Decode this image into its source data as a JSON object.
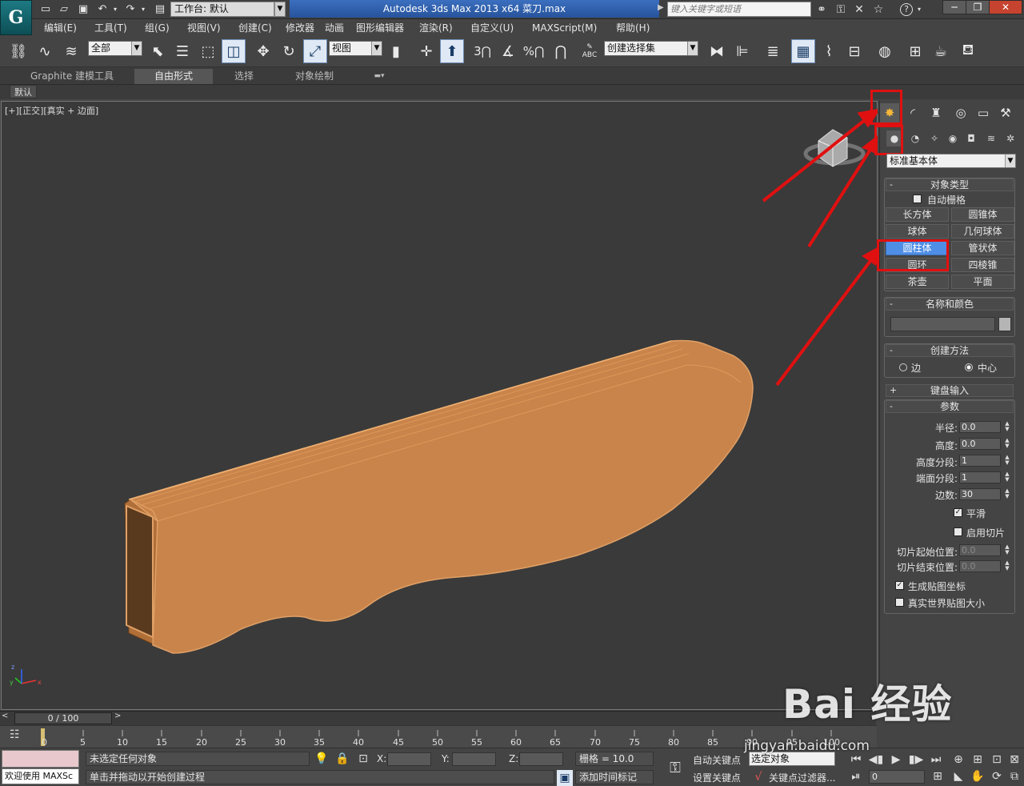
{
  "titlebar": {
    "logo": "G",
    "workspace": "工作台: 默认",
    "app_title": "Autodesk 3ds Max  2013 x64        菜刀.max",
    "search_placeholder": "键入关键字或短语",
    "help": "?"
  },
  "menus": [
    "编辑(E)",
    "工具(T)",
    "组(G)",
    "视图(V)",
    "创建(C)",
    "修改器",
    "动画",
    "图形编辑器",
    "渲染(R)",
    "自定义(U)",
    "MAXScript(M)",
    "帮助(H)"
  ],
  "toolbar": {
    "filter": "全部",
    "ref_coord": "视图",
    "named_sel": "创建选择集",
    "snap_3": "3",
    "percent": "%",
    "abc": "ABC"
  },
  "ribbon": {
    "tabs": [
      "Graphite 建模工具",
      "自由形式",
      "选择",
      "对象绘制"
    ],
    "default": "默认"
  },
  "viewport": {
    "label": "[+][正交][真实 + 边面]",
    "axis_x": "x",
    "axis_y": "y",
    "axis_z": "z"
  },
  "panel": {
    "category": "标准基本体",
    "object_type": {
      "title": "对象类型",
      "autogrid": "自动栅格",
      "buttons": [
        "长方体",
        "圆锥体",
        "球体",
        "几何球体",
        "圆柱体",
        "管状体",
        "圆环",
        "四棱锥",
        "茶壶",
        "平面"
      ],
      "selected": "圆柱体"
    },
    "name_color": {
      "title": "名称和颜色"
    },
    "creation_method": {
      "title": "创建方法",
      "opt1": "边",
      "opt2": "中心",
      "selected": "中心"
    },
    "keyboard_entry": {
      "title": "键盘输入"
    },
    "params": {
      "title": "参数",
      "radius": {
        "label": "半径:",
        "value": "0.0"
      },
      "height": {
        "label": "高度:",
        "value": "0.0"
      },
      "height_segs": {
        "label": "高度分段:",
        "value": "1"
      },
      "cap_segs": {
        "label": "端面分段:",
        "value": "1"
      },
      "sides": {
        "label": "边数:",
        "value": "30"
      },
      "smooth": "平滑",
      "slice_on": "启用切片",
      "slice_from": {
        "label": "切片起始位置:",
        "value": "0.0"
      },
      "slice_to": {
        "label": "切片结束位置:",
        "value": "0.0"
      },
      "gen_map": "生成贴图坐标",
      "real_world": "真实世界贴图大小"
    }
  },
  "timeline": {
    "frame": "0 / 100",
    "ticks": [
      "0",
      "5",
      "10",
      "15",
      "20",
      "25",
      "30",
      "35",
      "40",
      "45",
      "50",
      "55",
      "60",
      "65",
      "70",
      "75",
      "80",
      "85",
      "90",
      "95",
      "100"
    ]
  },
  "status": {
    "welcome": "欢迎使用 MAXSc",
    "selection": "未选定任何对象",
    "prompt": "单击并拖动以开始创建过程",
    "x": "X:",
    "y": "Y:",
    "z": "Z:",
    "grid": "栅格 = 10.0",
    "add_time_tag": "添加时间标记",
    "auto_key": "自动关键点",
    "set_key": "设置关键点",
    "selected_obj": "选定对象",
    "key_filters": "关键点过滤器...",
    "frame_field": "0"
  },
  "watermark": {
    "text": "Bai  经验",
    "url": "jingyan.baidu.com"
  },
  "colors": {
    "object": "#c8844a",
    "selected_button": "#4f8ee6",
    "annotation": "#e01010",
    "title_blue": "#3b6fbf"
  }
}
